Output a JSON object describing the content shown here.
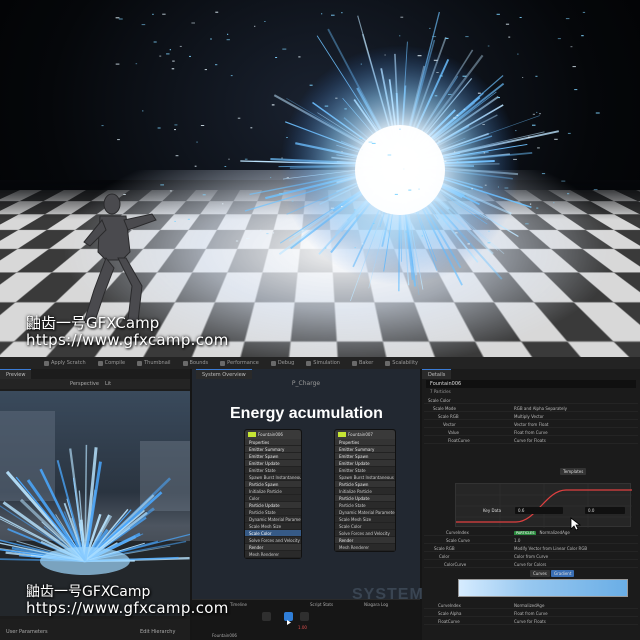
{
  "watermark": {
    "line1": "鼬齿一号GFXCamp",
    "line2": "https://www.gfxcamp.com"
  },
  "toolbar": {
    "items": [
      "Apply Scratch",
      "Compile",
      "Thumbnail",
      "Bounds",
      "Performance",
      "Debug",
      "Simulation",
      "Baker",
      "Scalability"
    ]
  },
  "preview": {
    "tab": "Preview",
    "perspective_label": "Perspective",
    "lit_label": "Lit",
    "params_label": "User Parameters",
    "hierarchy_label": "Edit Hierarchy"
  },
  "overview": {
    "tab": "System Overview",
    "header": "P_Charge",
    "title": "Energy acumulation",
    "system_label": "SYSTEM",
    "nodes": [
      {
        "name": "Fountain006",
        "rows": [
          "Properties",
          "Emitter Summary",
          "Emitter Spawn",
          "Emitter Update",
          "Emitter State",
          "Spawn Burst Instantaneous",
          "Particle Spawn",
          "Initialize Particle",
          "Color",
          "Particle Update",
          "Particle State",
          "Dynamic Material Parameters",
          "Scale Mesh Size",
          "Scale Color",
          "Solve Forces and Velocity",
          "Render",
          "Mesh Renderer"
        ]
      },
      {
        "name": "Fountain007",
        "rows": [
          "Properties",
          "Emitter Summary",
          "Emitter Spawn",
          "Emitter Update",
          "Emitter State",
          "Spawn Burst Instantaneous",
          "Particle Spawn",
          "Initialize Particle",
          "Particle Update",
          "Particle State",
          "Dynamic Material Parameters",
          "Scale Mesh Size",
          "Scale Color",
          "Solve Forces and Velocity",
          "Render",
          "Mesh Renderer"
        ]
      }
    ]
  },
  "details": {
    "tab": "Details",
    "search_value": "Fountain006",
    "particles": "7 Particles",
    "rows": [
      {
        "label": "Scale Color",
        "value": ""
      },
      {
        "label": "Scale Mode",
        "value": "RGB and Alpha Separately"
      },
      {
        "label": "Scale RGB",
        "value": "Multiply Vector"
      },
      {
        "label": "Vector",
        "value": "Vector from Float"
      },
      {
        "label": "Value",
        "value": "Float from Curve"
      },
      {
        "label": "FloatCurve",
        "value": "Curve for Floats"
      }
    ],
    "templates_label": "Templates",
    "key_time_label": "Key Data",
    "key_time_value": "0.6",
    "key_value": "0.0",
    "curve_index_label": "CurveIndex",
    "curve_index_badge": "PARTICLES",
    "curve_index_value": "NormalizedAge",
    "scale_curve_label": "Scale Curve",
    "scale_curve_value": "1.0",
    "scale_alpha": "Scale Alpha",
    "lower_rows": [
      {
        "label": "Scale RGB",
        "value": "Modify Vector from Linear Color RGB"
      },
      {
        "label": "Color",
        "value": "Color from Curve"
      },
      {
        "label": "ColorCurve",
        "value": "Curve for Colors"
      }
    ],
    "curves_btn": "Curves",
    "gradient_btn": "Gradient",
    "bottom_rows": [
      {
        "label": "CurveIndex",
        "value": "NormalizedAge"
      },
      {
        "label": "Scale Alpha",
        "value": "Float from Curve"
      },
      {
        "label": "FloatCurve",
        "value": "Curve for Floats"
      }
    ]
  },
  "timeline": {
    "tabs": [
      "Timeline",
      "Script Stats",
      "Niagara Log"
    ],
    "add_label": "Add",
    "emitter_label": "Fountain006",
    "frame": "1.00"
  },
  "icons": {
    "cursor": "cursor-arrow-icon",
    "play": "play-icon"
  }
}
